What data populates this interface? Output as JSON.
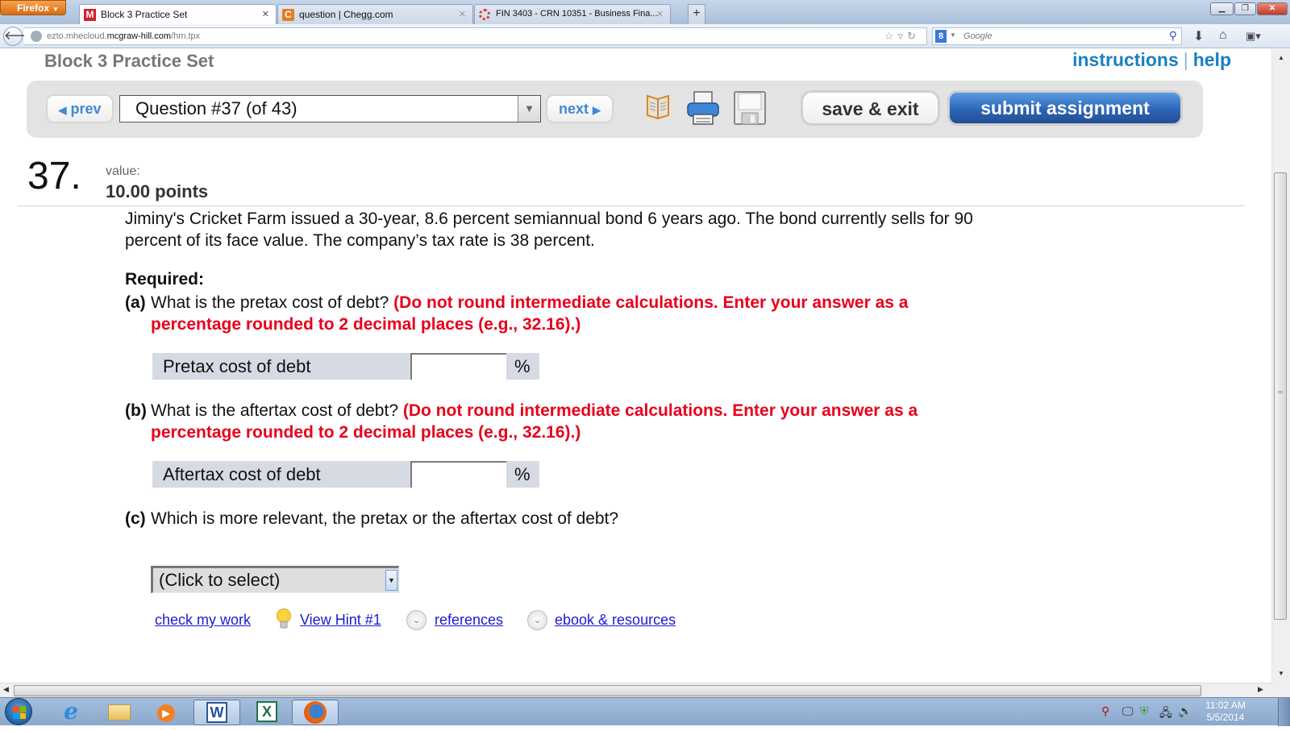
{
  "browser": {
    "menu_button": "Firefox",
    "tabs": [
      {
        "label": "Block 3 Practice Set",
        "favicon": "M",
        "favicon_color": "#d0202e",
        "active": true
      },
      {
        "label": "question | Chegg.com",
        "favicon": "C",
        "favicon_color": "#e87a1e",
        "active": false
      },
      {
        "label": "FIN 3403 - CRN 10351 - Business Fina...",
        "favicon": "ring",
        "favicon_color": "#e23b2d",
        "active": false
      }
    ],
    "new_tab_label": "+",
    "url_prefix": "ezto.mhecloud.",
    "url_domain": "mcgraw-hill.com",
    "url_path": "/hm.tpx",
    "search_placeholder": "Google"
  },
  "page": {
    "set_title": "Block 3 Practice Set",
    "links": {
      "instructions": "instructions",
      "separator": "|",
      "help": "help"
    },
    "toolbar": {
      "prev_label": "prev",
      "next_label": "next",
      "question_selector": "Question #37 (of 43)",
      "save_exit_label": "save & exit",
      "submit_label": "submit assignment"
    },
    "question": {
      "number": "37",
      "value_label": "value:",
      "points": "10.00 points",
      "stem": "Jiminy's Cricket Farm issued a 30-year, 8.6 percent semiannual bond 6 years ago. The bond currently sells for 90 percent of its face value. The company’s tax rate is 38 percent.",
      "required_label": "Required:",
      "parts": [
        {
          "label": "(a)",
          "text": "What is the pretax cost of debt?",
          "instruction": "(Do not round intermediate calculations. Enter your answer as a percentage rounded to 2 decimal places (e.g., 32.16).)",
          "answer_label": "Pretax cost of debt",
          "answer_value": "",
          "unit": "%"
        },
        {
          "label": "(b)",
          "text": "What is the aftertax cost of debt?",
          "instruction": "(Do not round intermediate calculations. Enter your answer as a percentage rounded to 2 decimal places (e.g., 32.16).)",
          "answer_label": "Aftertax cost of debt",
          "answer_value": "",
          "unit": "%"
        },
        {
          "label": "(c)",
          "text": "Which is more relevant, the pretax or the aftertax cost of debt?",
          "select_value": "(Click to select)"
        }
      ]
    },
    "footer_links": {
      "check": "check my work",
      "hint": "View Hint #1",
      "references": "references",
      "ebook": "ebook & resources"
    }
  },
  "taskbar": {
    "apps": [
      "start",
      "internet-explorer",
      "file-explorer",
      "media-player",
      "word",
      "excel",
      "firefox"
    ],
    "time": "11:02 AM",
    "date": "5/5/2014"
  }
}
